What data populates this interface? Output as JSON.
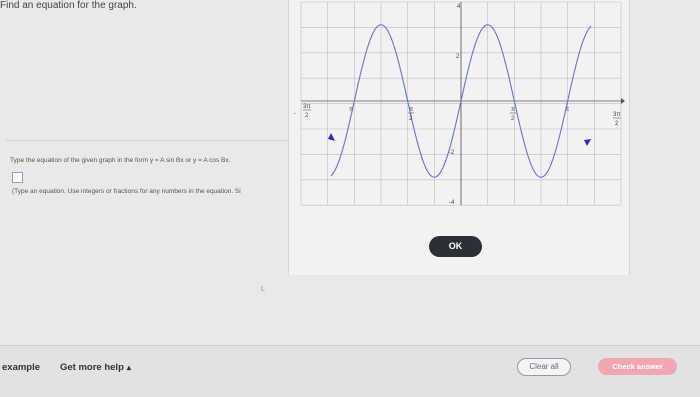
{
  "question": {
    "title": "Find an equation for the graph.",
    "prompt": "Type the equation of the given graph in the form y = A sin Bx or y = A cos Bx.",
    "hint": "(Type an equation. Use integers or fractions for any numbers in the equation. Si"
  },
  "graph": {
    "x_tick_labels": {
      "neg_3pi_2_num": "3π",
      "neg_3pi_2_den": "2",
      "neg_pi": "π",
      "neg_pi_2_num": "π",
      "neg_pi_2_den": "2",
      "pi_2_num": "π",
      "pi_2_den": "2",
      "pi": "π",
      "pos_3pi_2_num": "3π",
      "pos_3pi_2_den": "2"
    },
    "y_tick_labels": {
      "top": "4",
      "two": "2",
      "neg_two": "-2",
      "bottom": "-4"
    },
    "colors": {
      "curve": "#6f6fcf",
      "grid": "#bdbdc3",
      "axis": "#555555"
    },
    "curve_function": {
      "form": "y = A sin Bx",
      "amplitude": 3,
      "period_units_of_pi": 1
    }
  },
  "dialog": {
    "ok_label": "OK"
  },
  "misc": {
    "mark": "L"
  },
  "footer": {
    "example_label": "example",
    "help_label": "Get more help",
    "help_caret": "▴",
    "clear_label": "Clear all",
    "check_label": "Check answer"
  }
}
